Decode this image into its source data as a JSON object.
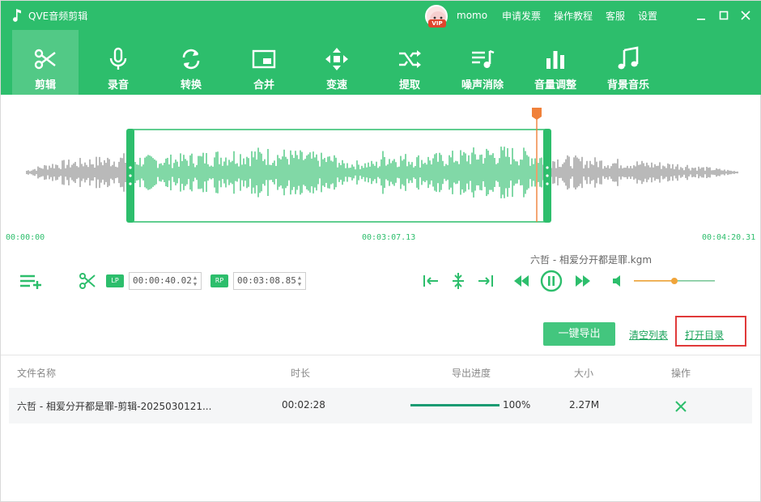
{
  "app": {
    "title": "QVE音频剪辑",
    "username": "momo",
    "vip_label": "VIP",
    "top_links": [
      "申请发票",
      "操作教程",
      "客服",
      "设置"
    ],
    "accent": "#2dbe6c"
  },
  "toolbar": {
    "items": [
      {
        "label": "剪辑",
        "icon": "scissors-icon",
        "active": true
      },
      {
        "label": "录音",
        "icon": "microphone-icon",
        "active": false
      },
      {
        "label": "转换",
        "icon": "convert-icon",
        "active": false
      },
      {
        "label": "合并",
        "icon": "merge-icon",
        "active": false
      },
      {
        "label": "变速",
        "icon": "speed-icon",
        "active": false
      },
      {
        "label": "提取",
        "icon": "extract-icon",
        "active": false
      },
      {
        "label": "噪声消除",
        "icon": "noise-icon",
        "active": false
      },
      {
        "label": "音量调整",
        "icon": "volume-bars-icon",
        "active": false
      },
      {
        "label": "背景音乐",
        "icon": "music-note-icon",
        "active": false
      }
    ]
  },
  "waveform": {
    "start_time": "00:00:00",
    "mid_time": "00:03:07.13",
    "end_time": "00:04:20.31"
  },
  "file": {
    "name": "六哲 - 相爱分开都是罪.kgm"
  },
  "clip": {
    "lp_label": "LP",
    "rp_label": "RP",
    "start": "00:00:40.02",
    "end": "00:03:08.85"
  },
  "actions": {
    "export_label": "一键导出",
    "clear_label": "清空列表",
    "open_dir_label": "打开目录"
  },
  "table": {
    "headers": [
      "文件名称",
      "时长",
      "导出进度",
      "大小",
      "操作"
    ],
    "rows": [
      {
        "name": "六哲 - 相爱分开都是罪-剪辑-2025030121...",
        "duration": "00:02:28",
        "progress_text": "100%",
        "progress": 1.0,
        "size": "2.27M"
      }
    ]
  },
  "volume_level": 0.5
}
